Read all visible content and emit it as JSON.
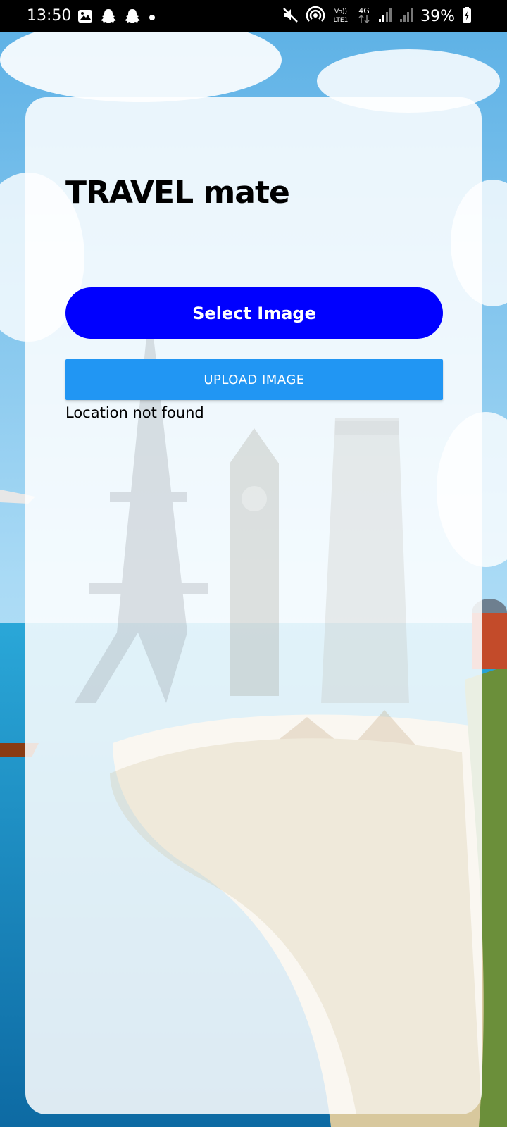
{
  "status_bar": {
    "time": "13:50",
    "battery": "39%",
    "icons": [
      "gallery-icon",
      "snapchat-icon",
      "snapchat-icon",
      "dot-icon",
      "mute-icon",
      "hotspot-icon",
      "volte-icon",
      "4g-icon",
      "signal-icon",
      "signal-icon",
      "battery-icon"
    ]
  },
  "app": {
    "title": "TRAVEL mate",
    "select_button_label": "Select Image",
    "upload_button_label": "UPLOAD IMAGE",
    "result_text": "Location not found"
  },
  "colors": {
    "select_button": "#0000ff",
    "upload_button": "#2196f3",
    "sky": "#7ec3ea"
  }
}
